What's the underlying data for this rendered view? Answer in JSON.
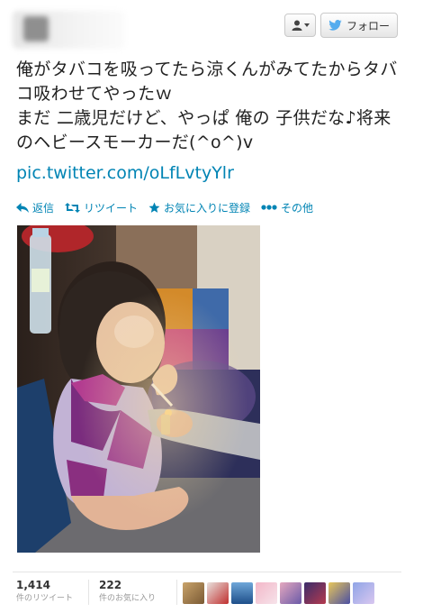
{
  "header": {
    "follow_label": "フォロー",
    "user_menu_icon": "person-icon"
  },
  "tweet": {
    "lines": [
      "俺がタバコを吸ってたら涼くんがみてたからタバ",
      "コ吸わせてやったｗ",
      "まだ 二歳児だけど、やっぱ 俺の 子供だな♪将来",
      "のヘビースモーカーだ(^o^)v"
    ],
    "link": "pic.twitter.com/oLfLvtyYlr"
  },
  "actions": {
    "reply": "返信",
    "retweet": "リツイート",
    "favorite": "お気に入りに登録",
    "more": "その他"
  },
  "stats": {
    "retweets_count": "1,414",
    "retweets_label": "件のリツイート",
    "favorites_count": "222",
    "favorites_label": "件のお気に入り"
  },
  "colors": {
    "link": "#0084b4",
    "twitter_bird": "#55acee"
  }
}
